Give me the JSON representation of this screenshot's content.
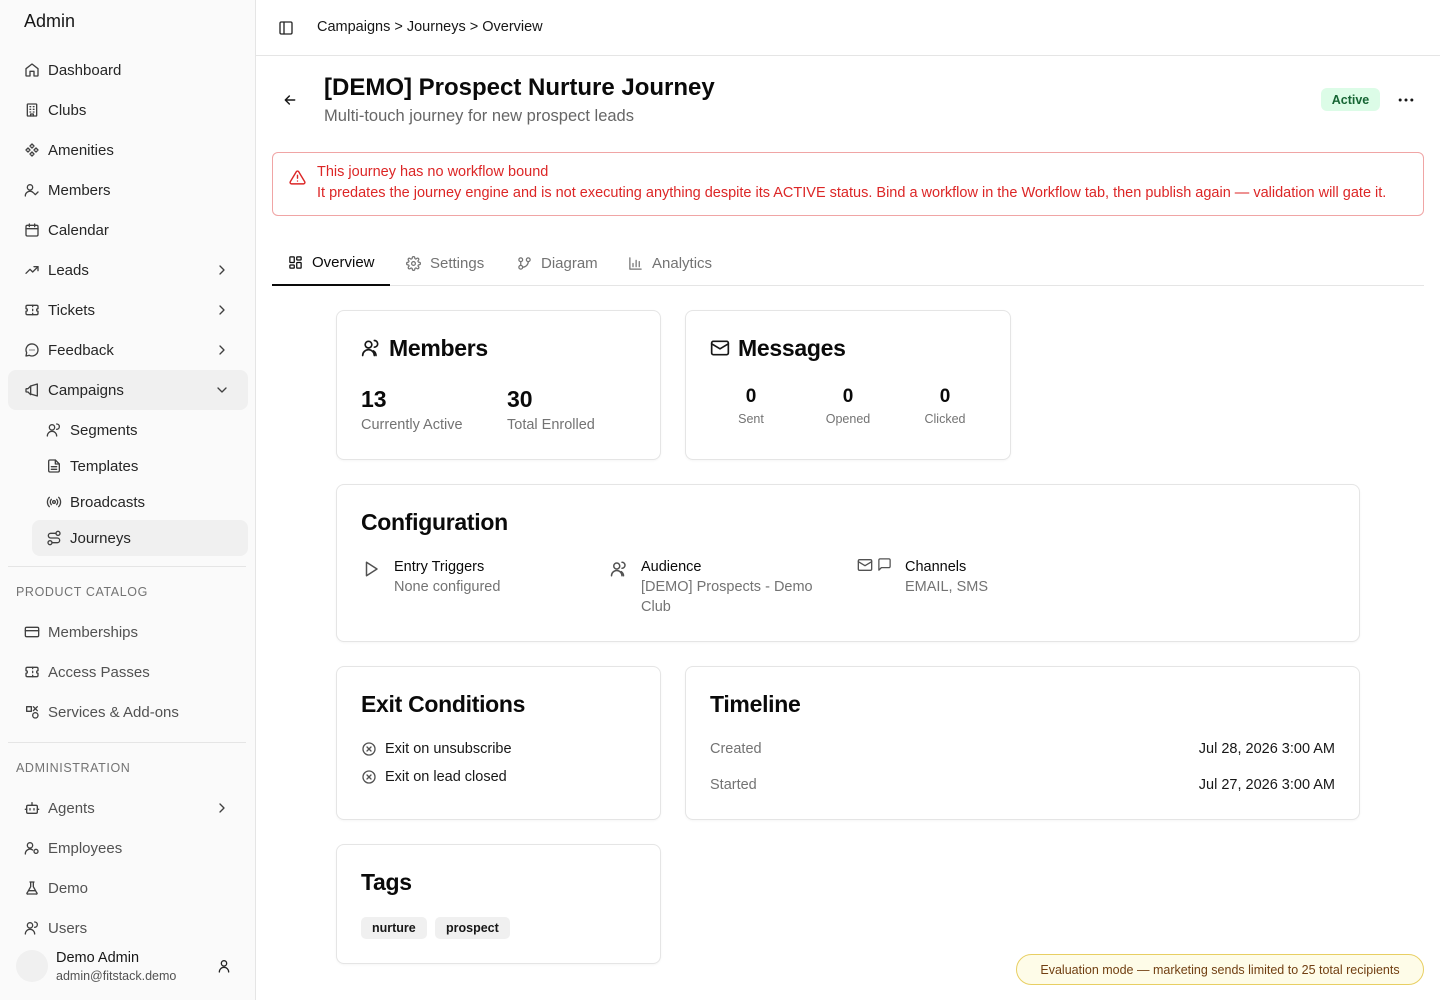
{
  "app": {
    "title": "Admin"
  },
  "sidebar": {
    "items": [
      {
        "label": "Dashboard"
      },
      {
        "label": "Clubs"
      },
      {
        "label": "Amenities"
      },
      {
        "label": "Members"
      },
      {
        "label": "Calendar"
      },
      {
        "label": "Leads"
      },
      {
        "label": "Tickets"
      },
      {
        "label": "Feedback"
      },
      {
        "label": "Campaigns"
      }
    ],
    "campaigns_sub": [
      {
        "label": "Segments"
      },
      {
        "label": "Templates"
      },
      {
        "label": "Broadcasts"
      },
      {
        "label": "Journeys"
      }
    ],
    "product_catalog": {
      "heading": "PRODUCT CATALOG",
      "items": [
        {
          "label": "Memberships"
        },
        {
          "label": "Access Passes"
        },
        {
          "label": "Services & Add-ons"
        }
      ]
    },
    "administration": {
      "heading": "ADMINISTRATION",
      "items": [
        {
          "label": "Agents"
        },
        {
          "label": "Employees"
        },
        {
          "label": "Demo"
        },
        {
          "label": "Users"
        }
      ]
    },
    "user": {
      "name": "Demo Admin",
      "email": "admin@fitstack.demo"
    }
  },
  "header": {
    "breadcrumb": "Campaigns > Journeys > Overview"
  },
  "journey": {
    "title": "[DEMO] Prospect Nurture Journey",
    "subtitle": "Multi-touch journey for new prospect leads",
    "status": "Active"
  },
  "alert": {
    "title": "This journey has no workflow bound",
    "description": "It predates the journey engine and is not executing anything despite its ACTIVE status. Bind a workflow in the Workflow tab, then publish again — validation will gate it."
  },
  "tabs": [
    {
      "label": "Overview"
    },
    {
      "label": "Settings"
    },
    {
      "label": "Diagram"
    },
    {
      "label": "Analytics"
    }
  ],
  "members_card": {
    "title": "Members",
    "active_value": "13",
    "active_label": "Currently Active",
    "enrolled_value": "30",
    "enrolled_label": "Total Enrolled"
  },
  "messages_card": {
    "title": "Messages",
    "stats": [
      {
        "value": "0",
        "label": "Sent"
      },
      {
        "value": "0",
        "label": "Opened"
      },
      {
        "value": "0",
        "label": "Clicked"
      }
    ]
  },
  "configuration": {
    "title": "Configuration",
    "entry_triggers": {
      "label": "Entry Triggers",
      "value": "None configured"
    },
    "audience": {
      "label": "Audience",
      "value": "[DEMO] Prospects - Demo Club"
    },
    "channels": {
      "label": "Channels",
      "value": "EMAIL, SMS"
    }
  },
  "exit_conditions": {
    "title": "Exit Conditions",
    "items": [
      "Exit on unsubscribe",
      "Exit on lead closed"
    ]
  },
  "timeline": {
    "title": "Timeline",
    "rows": [
      {
        "label": "Created",
        "value": "Jul 28, 2026 3:00 AM"
      },
      {
        "label": "Started",
        "value": "Jul 27, 2026 3:00 AM"
      }
    ]
  },
  "tags": {
    "title": "Tags",
    "items": [
      "nurture",
      "prospect"
    ]
  },
  "evaluation_notice": "Evaluation mode — marketing sends limited to 25 total recipients",
  "colors": {
    "accent": "#0a0a0a",
    "alert": "#dc2626",
    "status_bg": "#dcfce7",
    "status_fg": "#166534",
    "notice_bg": "#fefce8"
  }
}
